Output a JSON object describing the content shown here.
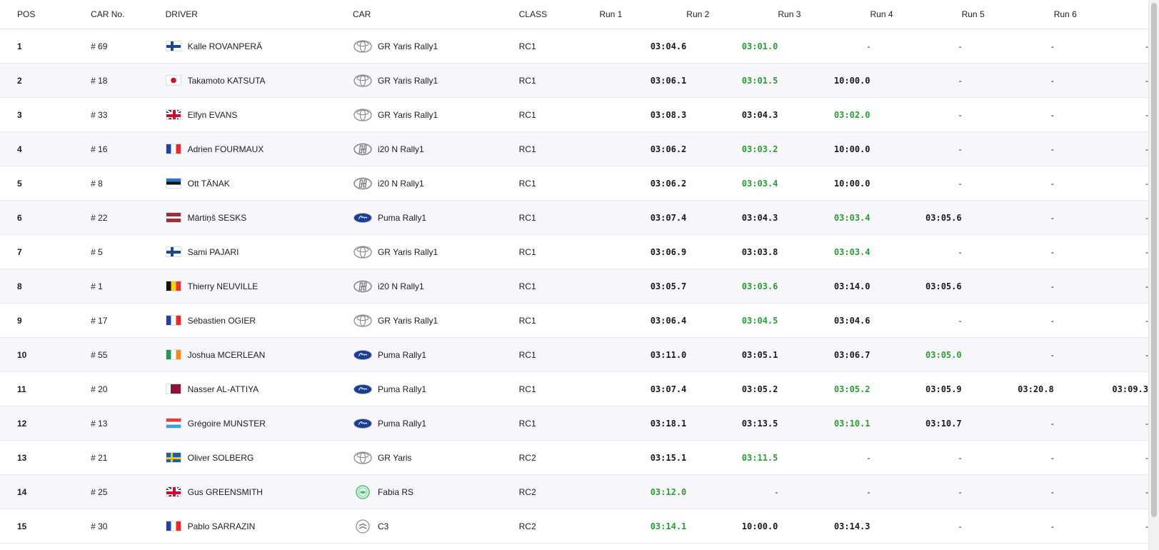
{
  "columns": {
    "pos": "POS",
    "car_no": "CAR No.",
    "driver": "DRIVER",
    "car": "CAR",
    "class": "CLASS",
    "runs": [
      "Run 1",
      "Run 2",
      "Run 3",
      "Run 4",
      "Run 5",
      "Run 6"
    ]
  },
  "colors": {
    "best_time": "#2d9a3a",
    "row_alt": "#f7f7f9"
  },
  "rows": [
    {
      "pos": "1",
      "car_no": "# 69",
      "driver": "Kalle ROVANPERÄ",
      "flag": "finland-flag-icon",
      "car": "GR Yaris Rally1",
      "make": "toyota-logo-icon",
      "class": "RC1",
      "runs": [
        "03:04.6",
        "03:01.0",
        "-",
        "-",
        "-",
        "-"
      ],
      "best": 1
    },
    {
      "pos": "2",
      "car_no": "# 18",
      "driver": "Takamoto KATSUTA",
      "flag": "japan-flag-icon",
      "car": "GR Yaris Rally1",
      "make": "toyota-logo-icon",
      "class": "RC1",
      "runs": [
        "03:06.1",
        "03:01.5",
        "10:00.0",
        "-",
        "-",
        "-"
      ],
      "best": 1
    },
    {
      "pos": "3",
      "car_no": "# 33",
      "driver": "Elfyn EVANS",
      "flag": "uk-flag-icon",
      "car": "GR Yaris Rally1",
      "make": "toyota-logo-icon",
      "class": "RC1",
      "runs": [
        "03:08.3",
        "03:04.3",
        "03:02.0",
        "-",
        "-",
        "-"
      ],
      "best": 2
    },
    {
      "pos": "4",
      "car_no": "# 16",
      "driver": "Adrien FOURMAUX",
      "flag": "france-flag-icon",
      "car": "i20 N Rally1",
      "make": "hyundai-logo-icon",
      "class": "RC1",
      "runs": [
        "03:06.2",
        "03:03.2",
        "10:00.0",
        "-",
        "-",
        "-"
      ],
      "best": 1
    },
    {
      "pos": "5",
      "car_no": "# 8",
      "driver": "Ott TÄNAK",
      "flag": "estonia-flag-icon",
      "car": "i20 N Rally1",
      "make": "hyundai-logo-icon",
      "class": "RC1",
      "runs": [
        "03:06.2",
        "03:03.4",
        "10:00.0",
        "-",
        "-",
        "-"
      ],
      "best": 1
    },
    {
      "pos": "6",
      "car_no": "# 22",
      "driver": "Mārtiņš SESKS",
      "flag": "latvia-flag-icon",
      "car": "Puma Rally1",
      "make": "ford-logo-icon",
      "class": "RC1",
      "runs": [
        "03:07.4",
        "03:04.3",
        "03:03.4",
        "03:05.6",
        "-",
        "-"
      ],
      "best": 2
    },
    {
      "pos": "7",
      "car_no": "# 5",
      "driver": "Sami PAJARI",
      "flag": "finland-flag-icon",
      "car": "GR Yaris Rally1",
      "make": "toyota-logo-icon",
      "class": "RC1",
      "runs": [
        "03:06.9",
        "03:03.8",
        "03:03.4",
        "-",
        "-",
        "-"
      ],
      "best": 2
    },
    {
      "pos": "8",
      "car_no": "# 1",
      "driver": "Thierry NEUVILLE",
      "flag": "belgium-flag-icon",
      "car": "i20 N Rally1",
      "make": "hyundai-logo-icon",
      "class": "RC1",
      "runs": [
        "03:05.7",
        "03:03.6",
        "03:14.0",
        "03:05.6",
        "-",
        "-"
      ],
      "best": 1
    },
    {
      "pos": "9",
      "car_no": "# 17",
      "driver": "Sébastien OGIER",
      "flag": "france-flag-icon",
      "car": "GR Yaris Rally1",
      "make": "toyota-logo-icon",
      "class": "RC1",
      "runs": [
        "03:06.4",
        "03:04.5",
        "03:04.6",
        "-",
        "-",
        "-"
      ],
      "best": 1
    },
    {
      "pos": "10",
      "car_no": "# 55",
      "driver": "Joshua MCERLEAN",
      "flag": "ireland-flag-icon",
      "car": "Puma Rally1",
      "make": "ford-logo-icon",
      "class": "RC1",
      "runs": [
        "03:11.0",
        "03:05.1",
        "03:06.7",
        "03:05.0",
        "-",
        "-"
      ],
      "best": 3
    },
    {
      "pos": "11",
      "car_no": "# 20",
      "driver": "Nasser AL-ATTIYA",
      "flag": "qatar-flag-icon",
      "car": "Puma Rally1",
      "make": "ford-logo-icon",
      "class": "RC1",
      "runs": [
        "03:07.4",
        "03:05.2",
        "03:05.2",
        "03:05.9",
        "03:20.8",
        "03:09.3"
      ],
      "best": 2
    },
    {
      "pos": "12",
      "car_no": "# 13",
      "driver": "Grégoire MUNSTER",
      "flag": "luxembourg-flag-icon",
      "car": "Puma Rally1",
      "make": "ford-logo-icon",
      "class": "RC1",
      "runs": [
        "03:18.1",
        "03:13.5",
        "03:10.1",
        "03:10.7",
        "-",
        "-"
      ],
      "best": 2
    },
    {
      "pos": "13",
      "car_no": "# 21",
      "driver": "Oliver SOLBERG",
      "flag": "sweden-flag-icon",
      "car": "GR Yaris",
      "make": "toyota-logo-icon",
      "class": "RC2",
      "runs": [
        "03:15.1",
        "03:11.5",
        "-",
        "-",
        "-",
        "-"
      ],
      "best": 1
    },
    {
      "pos": "14",
      "car_no": "# 25",
      "driver": "Gus GREENSMITH",
      "flag": "uk-flag-icon",
      "car": "Fabia RS",
      "make": "skoda-logo-icon",
      "class": "RC2",
      "runs": [
        "03:12.0",
        "-",
        "-",
        "-",
        "-",
        "-"
      ],
      "best": 0
    },
    {
      "pos": "15",
      "car_no": "# 30",
      "driver": "Pablo SARRAZIN",
      "flag": "france-flag-icon",
      "car": "C3",
      "make": "citroen-logo-icon",
      "class": "RC2",
      "runs": [
        "03:14.1",
        "10:00.0",
        "03:14.3",
        "-",
        "-",
        "-"
      ],
      "best": 0
    }
  ]
}
